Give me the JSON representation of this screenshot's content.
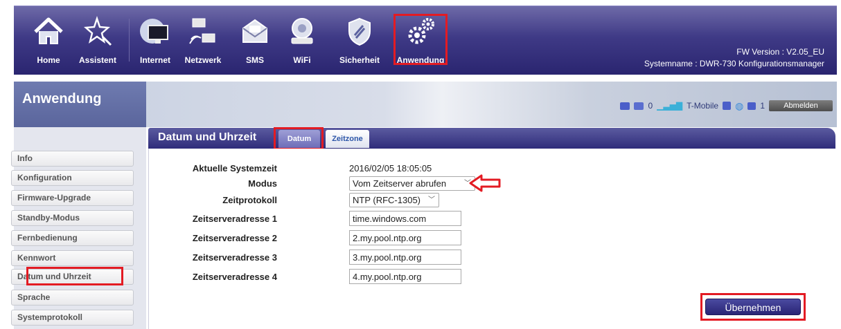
{
  "nav": {
    "items": [
      {
        "label": "Home",
        "icon": "home-icon"
      },
      {
        "label": "Assistent",
        "icon": "wand-icon"
      },
      {
        "label": "Internet",
        "icon": "globe-monitor-icon"
      },
      {
        "label": "Netzwerk",
        "icon": "network-icon"
      },
      {
        "label": "SMS",
        "icon": "envelope-icon"
      },
      {
        "label": "WiFi",
        "icon": "wifi-router-icon"
      },
      {
        "label": "Sicherheit",
        "icon": "shield-icon"
      },
      {
        "label": "Anwendung",
        "icon": "gears-icon"
      }
    ],
    "fw_version": "FW Version : V2.05_EU",
    "system_name": "Systemname : DWR-730 Konfigurationsmanager"
  },
  "section_title": "Anwendung",
  "status": {
    "sms_count": "0",
    "carrier": "T-Mobile",
    "clients": "1",
    "logout_label": "Abmelden"
  },
  "sidebar": {
    "items": [
      {
        "label": "Info"
      },
      {
        "label": "Konfiguration"
      },
      {
        "label": "Firmware-Upgrade"
      },
      {
        "label": "Standby-Modus"
      },
      {
        "label": "Fernbedienung"
      },
      {
        "label": "Kennwort"
      },
      {
        "label": "Datum und Uhrzeit"
      },
      {
        "label": "Sprache"
      },
      {
        "label": "Systemprotokoll"
      }
    ]
  },
  "content": {
    "title": "Datum und Uhrzeit",
    "tabs": [
      {
        "label": "Datum"
      },
      {
        "label": "Zeitzone"
      }
    ],
    "fields": {
      "system_time_label": "Aktuelle Systemzeit",
      "system_time_value": "2016/02/05 18:05:05",
      "mode_label": "Modus",
      "mode_value": "Vom Zeitserver abrufen",
      "protocol_label": "Zeitprotokoll",
      "protocol_value": "NTP (RFC-1305)",
      "server1_label": "Zeitserveradresse 1",
      "server1_value": "time.windows.com",
      "server2_label": "Zeitserveradresse 2",
      "server2_value": "2.my.pool.ntp.org",
      "server3_label": "Zeitserveradresse 3",
      "server3_value": "3.my.pool.ntp.org",
      "server4_label": "Zeitserveradresse 4",
      "server4_value": "4.my.pool.ntp.org"
    },
    "apply_label": "Übernehmen"
  },
  "colors": {
    "nav_bg": "#3f3a86",
    "highlight": "#e31b23",
    "apply_button": "#2a2575"
  }
}
